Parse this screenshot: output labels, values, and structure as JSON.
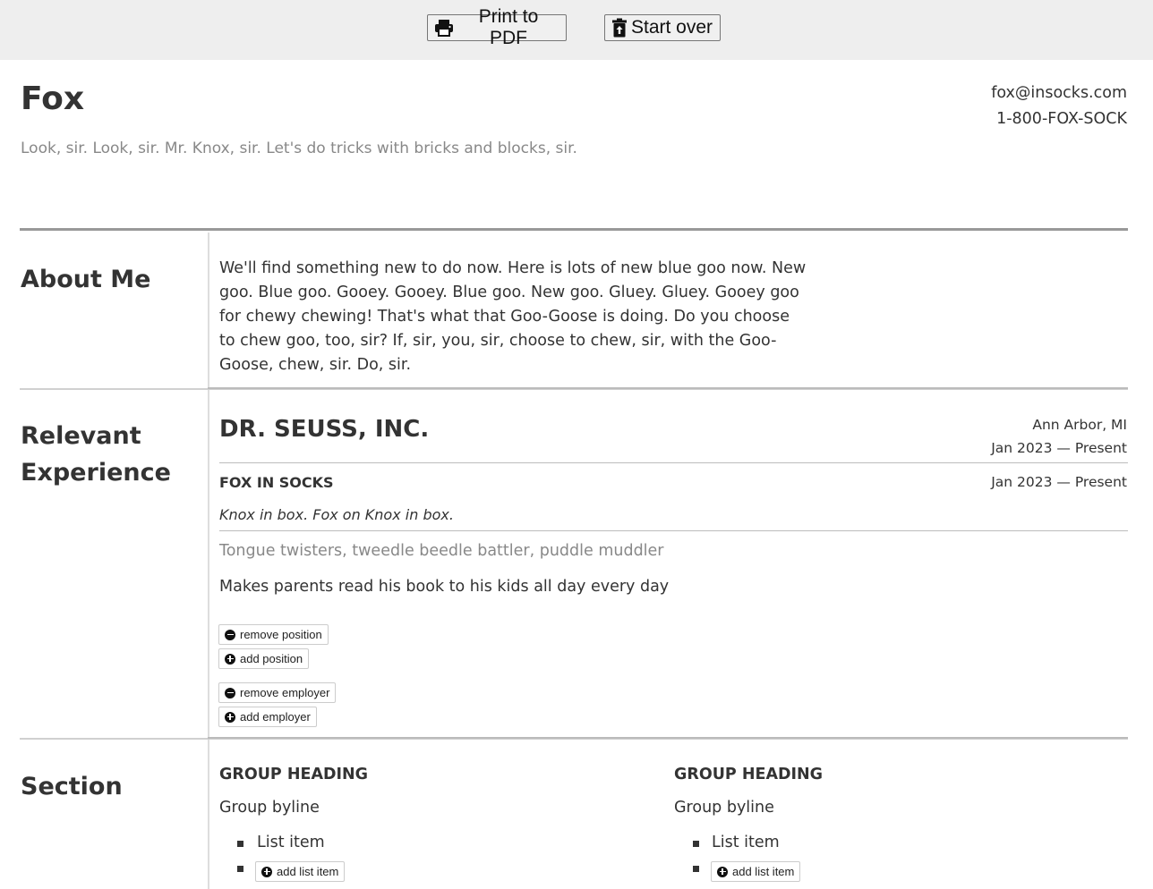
{
  "toolbar": {
    "print_label": "Print to PDF",
    "print_icon": "printer-icon",
    "reset_label": "Start over",
    "reset_icon": "trash-icon"
  },
  "header": {
    "name": "Fox",
    "tagline": "Look, sir. Look, sir. Mr. Knox, sir. Let's do tricks with bricks and blocks, sir.",
    "email": "fox@insocks.com",
    "phone": "1-800-FOX-SOCK"
  },
  "about": {
    "title": "About Me",
    "text": "We'll find something new to do now. Here is lots of new blue goo now. New goo. Blue goo. Gooey. Gooey. Blue goo. New goo. Gluey. Gluey. Gooey goo for chewy chewing! That's what that Goo-Goose is doing. Do you choose to chew goo, too, sir? If, sir, you, sir, choose to chew, sir, with the Goo-Goose, chew, sir. Do, sir."
  },
  "experience": {
    "title_line1": "Relevant",
    "title_line2": "Experience",
    "employer": {
      "name": "DR. SEUSS, INC.",
      "location": "Ann Arbor, MI",
      "dates": "Jan 2023 — Present"
    },
    "position": {
      "title": "FOX IN SOCKS",
      "dates": "Jan 2023 — Present",
      "summary": "Knox in box. Fox on Knox in box.",
      "skills": "Tongue twisters, tweedle beedle battler, puddle muddler",
      "duty": "Makes parents read his book to his kids all day every day"
    },
    "buttons": {
      "remove_position": "remove position",
      "add_position": "add position",
      "remove_employer": "remove employer",
      "add_employer": "add employer"
    }
  },
  "section": {
    "title": "Section",
    "groups": [
      {
        "heading": "GROUP HEADING",
        "byline": "Group byline",
        "item": "List item",
        "add_label": "add list item"
      },
      {
        "heading": "GROUP HEADING",
        "byline": "Group byline",
        "item": "List item",
        "add_label": "add list item"
      }
    ]
  },
  "icons": {
    "remove": "minus-circle-icon",
    "add": "plus-circle-icon"
  }
}
